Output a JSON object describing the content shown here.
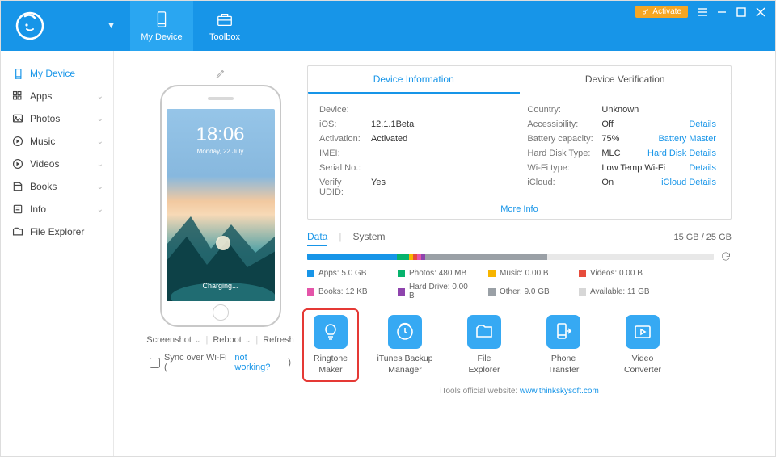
{
  "header": {
    "nav": [
      {
        "label": "My Device"
      },
      {
        "label": "Toolbox"
      }
    ],
    "activate": "Activate"
  },
  "sidebar": {
    "items": [
      {
        "label": "My Device",
        "expandable": false,
        "active": true
      },
      {
        "label": "Apps",
        "expandable": true
      },
      {
        "label": "Photos",
        "expandable": true
      },
      {
        "label": "Music",
        "expandable": true
      },
      {
        "label": "Videos",
        "expandable": true
      },
      {
        "label": "Books",
        "expandable": true
      },
      {
        "label": "Info",
        "expandable": true
      },
      {
        "label": "File Explorer",
        "expandable": false
      }
    ]
  },
  "phone": {
    "time": "18:06",
    "date": "Monday, 22 July",
    "charging": "Charging...",
    "actions": {
      "screenshot": "Screenshot",
      "reboot": "Reboot",
      "refresh": "Refresh"
    },
    "sync_label": "Sync over Wi-Fi (",
    "sync_link": "not working?",
    "sync_close": ")"
  },
  "tabs": {
    "info": "Device Information",
    "verify": "Device Verification"
  },
  "info": {
    "rows": [
      {
        "l": "Device:",
        "lv": "",
        "r": "Country:",
        "rv": "Unknown",
        "link": ""
      },
      {
        "l": "iOS:",
        "lv": "12.1.1Beta",
        "r": "Accessibility:",
        "rv": "Off",
        "link": "Details"
      },
      {
        "l": "Activation:",
        "lv": "Activated",
        "r": "Battery capacity:",
        "rv": "75%",
        "link": "Battery Master"
      },
      {
        "l": "IMEI:",
        "lv": "",
        "r": "Hard Disk Type:",
        "rv": "MLC",
        "link": "Hard Disk Details"
      },
      {
        "l": "Serial No.:",
        "lv": "",
        "r": "Wi-Fi type:",
        "rv": "Low Temp Wi-Fi",
        "link": "Details"
      },
      {
        "l": "Verify UDID:",
        "lv": "Yes",
        "r": "iCloud:",
        "rv": "On",
        "link": "iCloud Details"
      }
    ],
    "more": "More Info"
  },
  "storage": {
    "tab_data": "Data",
    "tab_system": "System",
    "total": "15 GB / 25 GB",
    "segments": [
      {
        "color": "#1795e8",
        "pct": 22
      },
      {
        "color": "#07b36d",
        "pct": 3
      },
      {
        "color": "#f7b500",
        "pct": 1
      },
      {
        "color": "#e74c3c",
        "pct": 1
      },
      {
        "color": "#e455a9",
        "pct": 1
      },
      {
        "color": "#8e44ad",
        "pct": 1
      },
      {
        "color": "#9aa0a6",
        "pct": 30
      }
    ],
    "legend": [
      {
        "color": "#1795e8",
        "label": "Apps: 5.0 GB"
      },
      {
        "color": "#07b36d",
        "label": "Photos: 480 MB"
      },
      {
        "color": "#f7b500",
        "label": "Music: 0.00 B"
      },
      {
        "color": "#e74c3c",
        "label": "Videos: 0.00 B"
      },
      {
        "color": "#e455a9",
        "label": "Books: 12 KB"
      },
      {
        "color": "#8e44ad",
        "label": "Hard Drive: 0.00 B"
      },
      {
        "color": "#9aa0a6",
        "label": "Other: 9.0 GB"
      },
      {
        "color": "#d7d7d7",
        "label": "Available: 11 GB"
      }
    ]
  },
  "tools": [
    {
      "label": "Ringtone Maker",
      "highlight": true
    },
    {
      "label": "iTunes Backup Manager"
    },
    {
      "label": "File Explorer"
    },
    {
      "label": "Phone Transfer"
    },
    {
      "label": "Video Converter"
    }
  ],
  "footer": {
    "prefix": "iTools official website: ",
    "link": "www.thinkskysoft.com"
  }
}
